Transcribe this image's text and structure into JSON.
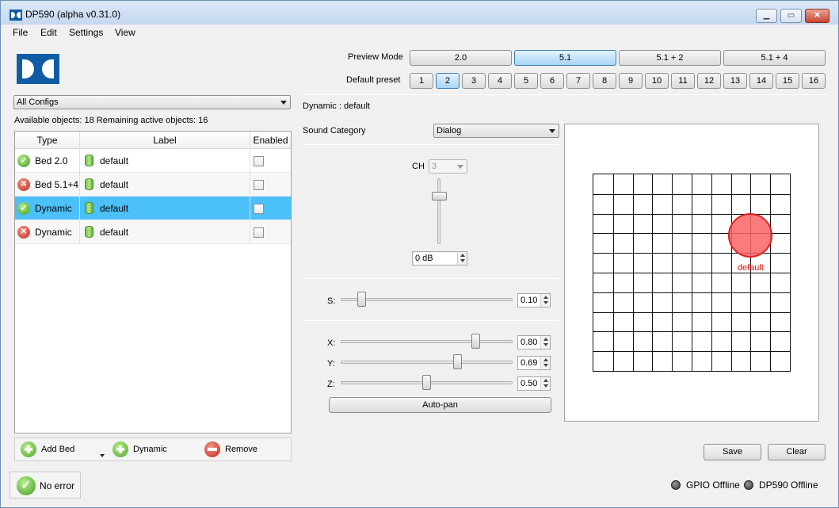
{
  "window": {
    "title": "DP590 (alpha v0.31.0)",
    "min_icon": "minimize-icon",
    "max_icon": "maximize-icon",
    "close_icon": "close-icon",
    "min_glyph": "▁",
    "max_glyph": "▭",
    "close_glyph": "✕"
  },
  "menu": [
    "File",
    "Edit",
    "Settings",
    "View"
  ],
  "left": {
    "config_select": "All Configs",
    "info": "Available objects: 18 Remaining active objects: 16",
    "table": {
      "headers": [
        "Type",
        "Label",
        "Enabled"
      ],
      "rows": [
        {
          "status": "ok",
          "type": "Bed 2.0",
          "label": "default",
          "enabled": false,
          "selected": false
        },
        {
          "status": "error",
          "type": "Bed 5.1+4",
          "label": "default",
          "enabled": false,
          "selected": false
        },
        {
          "status": "ok",
          "type": "Dynamic",
          "label": "default",
          "enabled": false,
          "selected": true
        },
        {
          "status": "error",
          "type": "Dynamic",
          "label": "default",
          "enabled": false,
          "selected": false
        }
      ]
    },
    "buttons": {
      "add_bed": "Add Bed",
      "dynamic": "Dynamic",
      "remove": "Remove"
    },
    "status": "No error"
  },
  "preview": {
    "label": "Preview Mode",
    "modes": [
      "2.0",
      "5.1",
      "5.1 + 2",
      "5.1 + 4"
    ],
    "active_mode": "5.1"
  },
  "presets": {
    "label": "Default preset",
    "items": [
      "1",
      "2",
      "3",
      "4",
      "5",
      "6",
      "7",
      "8",
      "9",
      "10",
      "11",
      "12",
      "13",
      "14",
      "15",
      "16"
    ],
    "active": "2"
  },
  "object": {
    "title": "Dynamic : default",
    "sound_category_label": "Sound Category",
    "sound_category": "Dialog",
    "ch_label": "CH",
    "ch_value": "3",
    "gain": "0 dB",
    "gain_level": 0.77,
    "s_label": "S:",
    "s_value": "0.10",
    "x_label": "X:",
    "x_value": "0.80",
    "y_label": "Y:",
    "y_value": "0.69",
    "z_label": "Z:",
    "z_value": "0.50",
    "autopan": "Auto-pan"
  },
  "canvas": {
    "object_label": "default",
    "grid_divisions": 10
  },
  "actions": {
    "save": "Save",
    "clear": "Clear"
  },
  "status_bar": {
    "gpio": "GPIO Offline",
    "dp590": "DP590 Offline"
  }
}
